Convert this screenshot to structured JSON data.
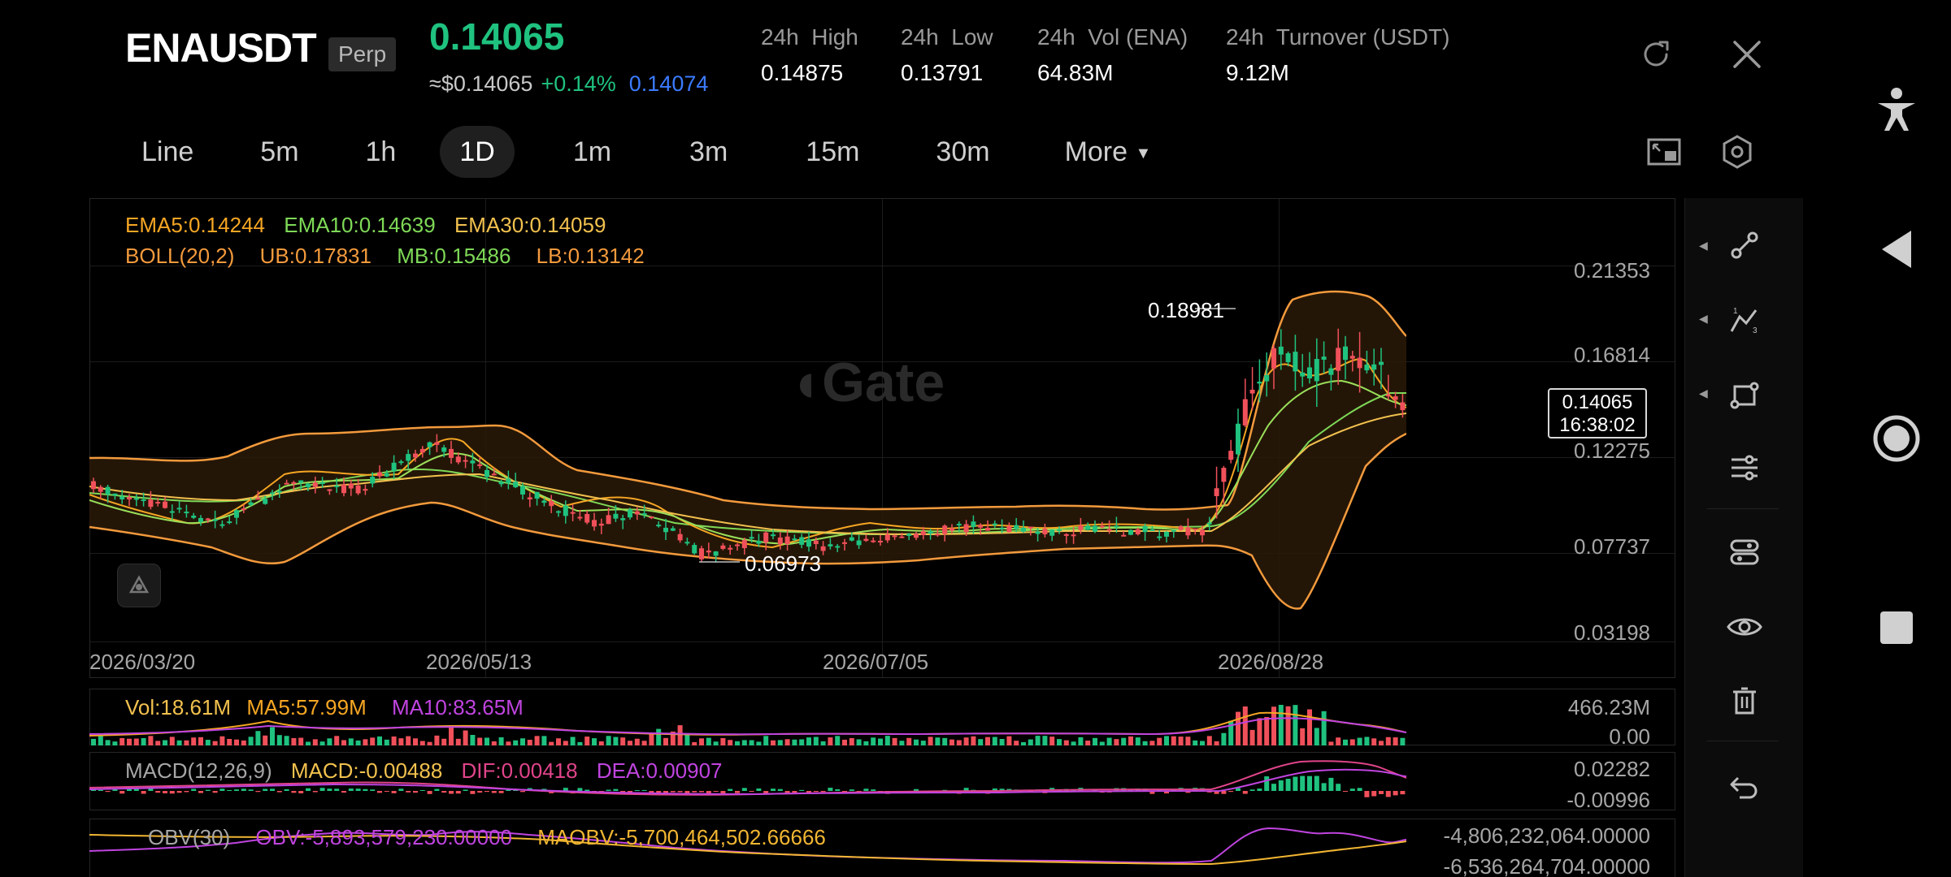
{
  "header": {
    "symbol": "ENAUSDT",
    "contract_type": "Perp",
    "last_price": "0.14065",
    "fiat_price": "≈$0.14065",
    "change_pct": "+0.14%",
    "mark_price": "0.14074",
    "stats": [
      {
        "label": "24h  High",
        "value": "0.14875"
      },
      {
        "label": "24h  Low",
        "value": "0.13791"
      },
      {
        "label": "24h  Vol (ENA)",
        "value": "64.83M"
      },
      {
        "label": "24h  Turnover (USDT)",
        "value": "9.12M"
      }
    ],
    "icons": {
      "refresh": "refresh-icon",
      "close": "close-icon"
    }
  },
  "intervals": {
    "items": [
      "Line",
      "5m",
      "1h",
      "1D",
      "1m",
      "3m",
      "15m",
      "30m",
      "More"
    ],
    "active": "1D",
    "more_caret": "▼"
  },
  "chart": {
    "watermark": "Gate",
    "ema_legend": {
      "ema5": "EMA5:0.14244",
      "ema10": "EMA10:0.14639",
      "ema30": "EMA30:0.14059"
    },
    "boll_legend": {
      "name": "BOLL(20,2)",
      "ub": "UB:0.17831",
      "mb": "MB:0.15486",
      "lb": "LB:0.13142"
    },
    "price_axis": [
      "0.21353",
      "0.16814",
      "0.12275",
      "0.07737",
      "0.03198"
    ],
    "date_axis": [
      "2026/03/20",
      "2026/05/13",
      "2026/07/05",
      "2026/08/28"
    ],
    "high_marker": "0.18981",
    "low_marker": "0.06973",
    "current_price": "0.14065",
    "countdown": "16:38:02"
  },
  "volume": {
    "legend": {
      "vol": "Vol:18.61M",
      "ma5": "MA5:57.99M",
      "ma10": "MA10:83.65M"
    },
    "axis": [
      "466.23M",
      "0.00"
    ]
  },
  "macd": {
    "legend": {
      "name": "MACD(12,26,9)",
      "macd": "MACD:-0.00488",
      "dif": "DIF:0.00418",
      "dea": "DEA:0.00907"
    },
    "axis": [
      "0.02282",
      "-0.00996"
    ]
  },
  "obv": {
    "legend": {
      "name": "OBV(30)",
      "obv": "OBV:-5,893,579,230.00000",
      "maobv": "MAOBV:-5,700,464,502.66666"
    },
    "axis": [
      "-4,806,232,064.00000",
      "-6,536,264,704.00000"
    ]
  },
  "colors": {
    "up": "#1fc27f",
    "down": "#f0505a",
    "ema5": "#f5a623",
    "ema10": "#7ed957",
    "ema30": "#f2c14e",
    "boll": "#f39a3c",
    "mb": "#7ed957",
    "dif": "#e0448a",
    "dea": "#c044e0",
    "maobv": "#f2b632"
  },
  "toolbar": [
    "trend-line-icon",
    "fibonacci-icon",
    "shape-icon",
    "settings-sliders-icon",
    "indicator-icon",
    "visibility-icon",
    "delete-icon",
    "undo-icon"
  ],
  "system_nav": [
    "accessibility-icon",
    "back-icon",
    "home-icon",
    "recents-icon"
  ]
}
